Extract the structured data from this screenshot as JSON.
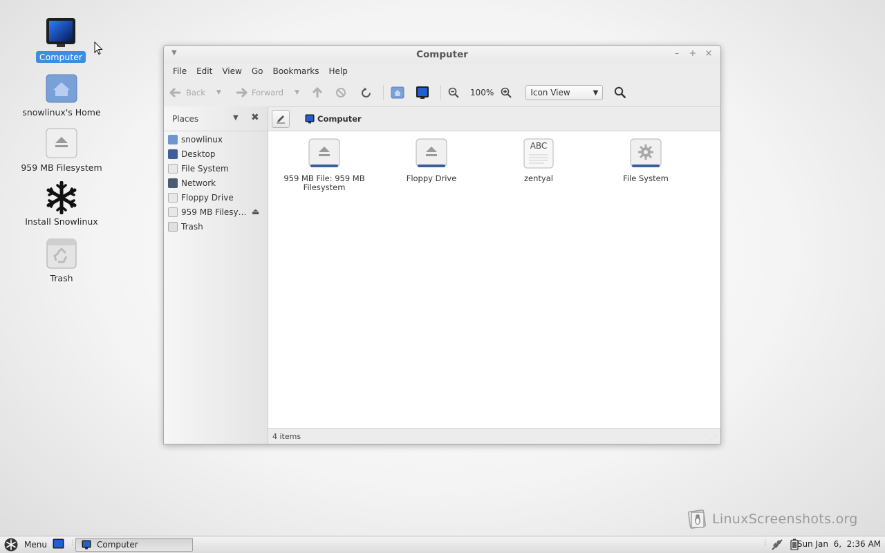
{
  "desktop": {
    "icons": [
      {
        "label": "Computer",
        "icon": "computer-icon"
      },
      {
        "label": "snowlinux's Home",
        "icon": "home-folder-icon"
      },
      {
        "label": "959 MB Filesystem",
        "icon": "removable-drive-icon"
      },
      {
        "label": "Install Snowlinux",
        "icon": "snowflake-icon"
      },
      {
        "label": "Trash",
        "icon": "trash-icon"
      }
    ]
  },
  "window": {
    "title": "Computer",
    "menu": [
      "File",
      "Edit",
      "View",
      "Go",
      "Bookmarks",
      "Help"
    ],
    "toolbar": {
      "back": "Back",
      "forward": "Forward",
      "zoom": "100%",
      "view_mode": "Icon View"
    },
    "sidebar": {
      "title": "Places",
      "items": [
        {
          "label": "snowlinux",
          "icon": "home-folder-icon",
          "color": "#6f95cf"
        },
        {
          "label": "Desktop",
          "icon": "desktop-icon",
          "color": "#3f5f96"
        },
        {
          "label": "File System",
          "icon": "filesystem-icon",
          "color": "#bcbcbc"
        },
        {
          "label": "Network",
          "icon": "network-icon",
          "color": "#4a5a72"
        },
        {
          "label": "Floppy Drive",
          "icon": "floppy-icon",
          "color": "#c8c8c8"
        },
        {
          "label": "959 MB Filesy…",
          "icon": "removable-drive-icon",
          "color": "#c8c8c8"
        },
        {
          "label": "Trash",
          "icon": "trash-icon",
          "color": "#bdbdbd"
        }
      ]
    },
    "pathbar": {
      "crumb": "Computer"
    },
    "files": [
      {
        "label": "959 MB File: 959 MB Filesystem",
        "icon": "removable-drive-icon"
      },
      {
        "label": "Floppy Drive",
        "icon": "floppy-icon"
      },
      {
        "label": "zentyal",
        "icon": "optical-disc-icon",
        "badge": "ABC"
      },
      {
        "label": "File System",
        "icon": "filesystem-icon"
      }
    ],
    "status": "4 items"
  },
  "watermark": "LinuxScreenshots.org",
  "panel": {
    "menu_label": "Menu",
    "task_label": "Computer",
    "clock": "Sun Jan  6,  2:36 AM"
  },
  "colors": {
    "accent": "#3d8ee0",
    "computer_screen": "#0b3d91"
  }
}
